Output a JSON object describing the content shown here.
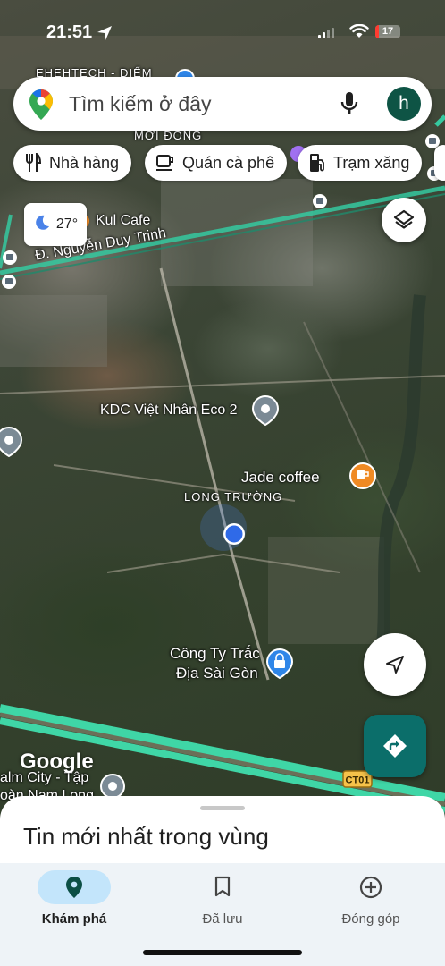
{
  "status": {
    "time": "21:51",
    "battery": "17"
  },
  "search": {
    "placeholder": "Tìm kiếm ở đây",
    "avatar_letter": "h"
  },
  "chips": [
    {
      "label": "Nhà hàng",
      "icon": "fork-knife-icon"
    },
    {
      "label": "Quán cà phê",
      "icon": "coffee-cup-icon"
    },
    {
      "label": "Trạm xăng",
      "icon": "gas-station-icon"
    }
  ],
  "weather": {
    "temp": "27°",
    "icon": "moon-icon"
  },
  "map": {
    "labels": {
      "top_partial": "EHEHTECH - DIỂM",
      "moi_dong": "MỚI ĐÔNG",
      "kul_cafe": "Kul Cafe",
      "street": "Đ. Nguyễn Duy Trinh",
      "kdc": "KDC Việt Nhân Eco 2",
      "jade": "Jade coffee",
      "long_truong": "LONG TRƯỜNG",
      "cong_ty_1": "Công Ty Trắc",
      "cong_ty_2": "Địa Sài Gòn",
      "palm_1": "alm City - Tập",
      "palm_2": "oàn Nam Long",
      "highway": "CT01"
    },
    "attribution": "Google"
  },
  "sheet": {
    "title": "Tin mới nhất trong vùng"
  },
  "nav": [
    {
      "label": "Khám phá",
      "icon": "explore-pin-icon",
      "active": true
    },
    {
      "label": "Đã lưu",
      "icon": "bookmark-icon",
      "active": false
    },
    {
      "label": "Đóng góp",
      "icon": "add-circle-icon",
      "active": false
    }
  ]
}
